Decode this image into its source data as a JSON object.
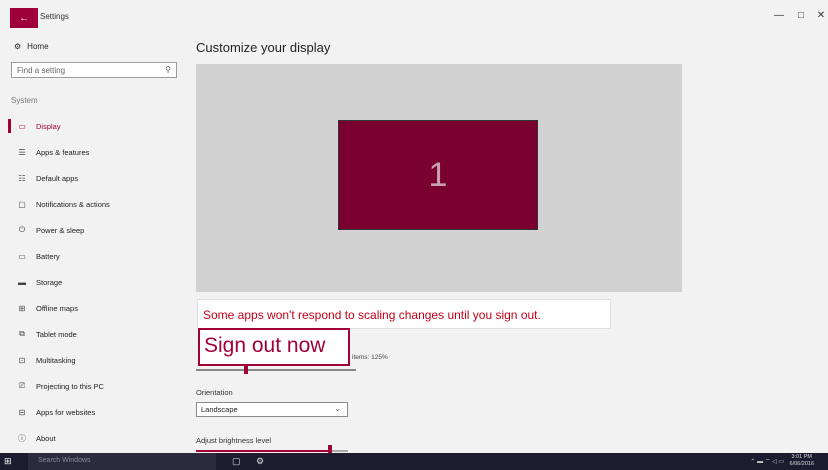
{
  "window": {
    "title": "Settings",
    "back_icon": "back-arrow-icon",
    "minimize": "—",
    "maximize": "□",
    "close": "✕"
  },
  "sidebar": {
    "home_label": "Home",
    "search_placeholder": "Find a setting",
    "section_label": "System",
    "items": [
      {
        "label": "Display",
        "icon": "monitor-icon",
        "glyph": "▭",
        "active": true
      },
      {
        "label": "Apps & features",
        "icon": "list-icon",
        "glyph": "☰",
        "active": false
      },
      {
        "label": "Default apps",
        "icon": "default-apps-icon",
        "glyph": "☷",
        "active": false
      },
      {
        "label": "Notifications & actions",
        "icon": "notification-icon",
        "glyph": "▢",
        "active": false
      },
      {
        "label": "Power & sleep",
        "icon": "power-icon",
        "glyph": "⏻",
        "active": false
      },
      {
        "label": "Battery",
        "icon": "battery-icon",
        "glyph": "▭",
        "active": false
      },
      {
        "label": "Storage",
        "icon": "storage-icon",
        "glyph": "▬",
        "active": false
      },
      {
        "label": "Offline maps",
        "icon": "map-icon",
        "glyph": "⊞",
        "active": false
      },
      {
        "label": "Tablet mode",
        "icon": "tablet-icon",
        "glyph": "⧉",
        "active": false
      },
      {
        "label": "Multitasking",
        "icon": "multitasking-icon",
        "glyph": "⊡",
        "active": false
      },
      {
        "label": "Projecting to this PC",
        "icon": "projecting-icon",
        "glyph": "⎚",
        "active": false
      },
      {
        "label": "Apps for websites",
        "icon": "apps-websites-icon",
        "glyph": "⊟",
        "active": false
      },
      {
        "label": "About",
        "icon": "info-icon",
        "glyph": "ⓘ",
        "active": false
      }
    ]
  },
  "main": {
    "title": "Customize your display",
    "monitor_number": "1",
    "callout_text": "Some apps won't respond to scaling changes until you sign out.",
    "signout_label": "Sign out now",
    "scale_text": "items: 125%",
    "orientation_label": "Orientation",
    "orientation_value": "Landscape",
    "brightness_label": "Adjust brightness level",
    "brightness_level": 0.88
  },
  "taskbar": {
    "search_placeholder": "Search Windows",
    "time": "3:01 PM",
    "date": "6/06/2016"
  },
  "colors": {
    "accent": "#a0003a",
    "warning_text": "#c00018",
    "taskbar": "#1c1c2e"
  }
}
